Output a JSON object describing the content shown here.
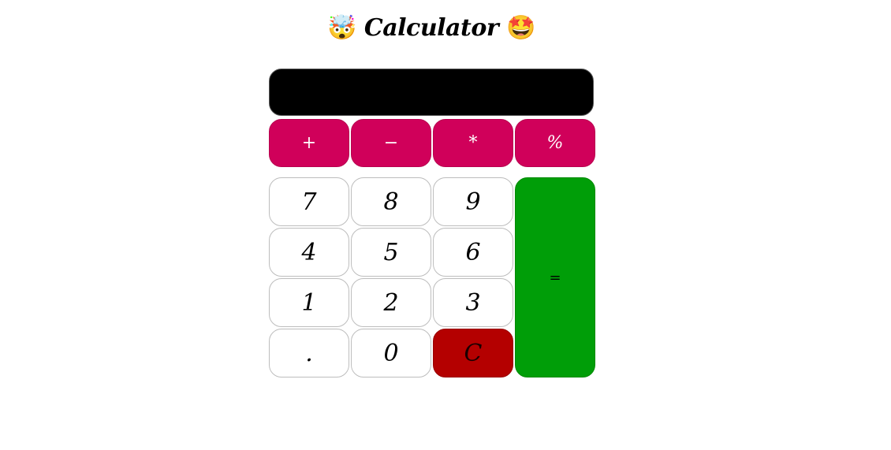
{
  "app": {
    "title_emoji_left": "🤯",
    "title_text": "Calculator",
    "title_emoji_right": "🤩"
  },
  "display": {
    "value": ""
  },
  "operators": {
    "add": "+",
    "subtract": "−",
    "multiply": "*",
    "percent": "%"
  },
  "keys": {
    "seven": "7",
    "eight": "8",
    "nine": "9",
    "four": "4",
    "five": "5",
    "six": "6",
    "one": "1",
    "two": "2",
    "three": "3",
    "decimal": ".",
    "zero": "0",
    "clear": "C",
    "equals": "="
  },
  "colors": {
    "operator": "#d0005a",
    "equals": "#009e08",
    "clear": "#b40000",
    "display": "#000000"
  }
}
